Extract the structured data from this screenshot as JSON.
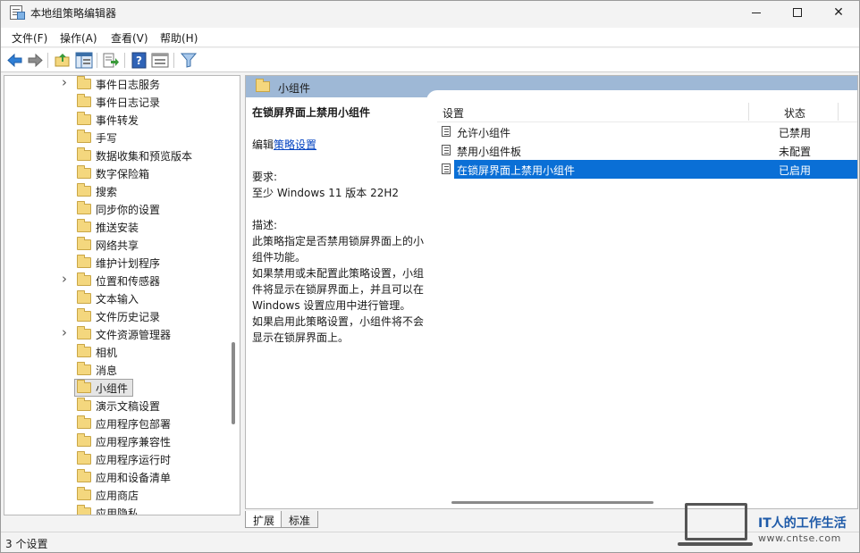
{
  "window": {
    "title": "本地组策略编辑器",
    "icon": "policy-editor-icon"
  },
  "menu": {
    "items": [
      "文件(F)",
      "操作(A)",
      "查看(V)",
      "帮助(H)"
    ]
  },
  "toolbar": {
    "icons": [
      "back-arrow-icon",
      "forward-arrow-icon",
      "up-folder-icon",
      "show-hide-tree-icon",
      "export-list-icon",
      "help-icon",
      "properties-icon",
      "filter-icon"
    ]
  },
  "tree": {
    "items": [
      {
        "label": "事件日志服务",
        "expandable": true
      },
      {
        "label": "事件日志记录",
        "expandable": false
      },
      {
        "label": "事件转发",
        "expandable": false
      },
      {
        "label": "手写",
        "expandable": false
      },
      {
        "label": "数据收集和预览版本",
        "expandable": false
      },
      {
        "label": "数字保险箱",
        "expandable": false
      },
      {
        "label": "搜索",
        "expandable": false
      },
      {
        "label": "同步你的设置",
        "expandable": false
      },
      {
        "label": "推送安装",
        "expandable": false
      },
      {
        "label": "网络共享",
        "expandable": false
      },
      {
        "label": "维护计划程序",
        "expandable": false
      },
      {
        "label": "位置和传感器",
        "expandable": true
      },
      {
        "label": "文本输入",
        "expandable": false
      },
      {
        "label": "文件历史记录",
        "expandable": false
      },
      {
        "label": "文件资源管理器",
        "expandable": true
      },
      {
        "label": "相机",
        "expandable": false
      },
      {
        "label": "消息",
        "expandable": false
      },
      {
        "label": "小组件",
        "expandable": false,
        "selected": true
      },
      {
        "label": "演示文稿设置",
        "expandable": false
      },
      {
        "label": "应用程序包部署",
        "expandable": false
      },
      {
        "label": "应用程序兼容性",
        "expandable": false
      },
      {
        "label": "应用程序运行时",
        "expandable": false
      },
      {
        "label": "应用和设备清单",
        "expandable": false
      },
      {
        "label": "应用商店",
        "expandable": false
      },
      {
        "label": "应用隐私",
        "expandable": false
      }
    ]
  },
  "right_pane": {
    "header": "小组件",
    "description": {
      "title": "在锁屏界面上禁用小组件",
      "edit_prefix": "编辑",
      "edit_link": "策略设置",
      "requirements_label": "要求:",
      "requirements_value": "至少 Windows 11 版本 22H2",
      "desc_label": "描述:",
      "desc_lines": [
        "此策略指定是否禁用锁屏界面上的小",
        "组件功能。",
        "如果禁用或未配置此策略设置，小组",
        "件将显示在锁屏界面上，并且可以在",
        "Windows 设置应用中进行管理。",
        "如果启用此策略设置，小组件将不会",
        "显示在锁屏界面上。"
      ]
    },
    "table": {
      "col_setting": "设置",
      "col_state": "状态",
      "rows": [
        {
          "name": "允许小组件",
          "state": "已禁用"
        },
        {
          "name": "禁用小组件板",
          "state": "未配置"
        },
        {
          "name": "在锁屏界面上禁用小组件",
          "state": "已启用",
          "selected": true
        }
      ]
    },
    "tabs": [
      "扩展",
      "标准"
    ]
  },
  "status": {
    "text": "3 个设置"
  },
  "watermark": {
    "title": "IT人的工作生活",
    "url": "www.cntse.com"
  }
}
